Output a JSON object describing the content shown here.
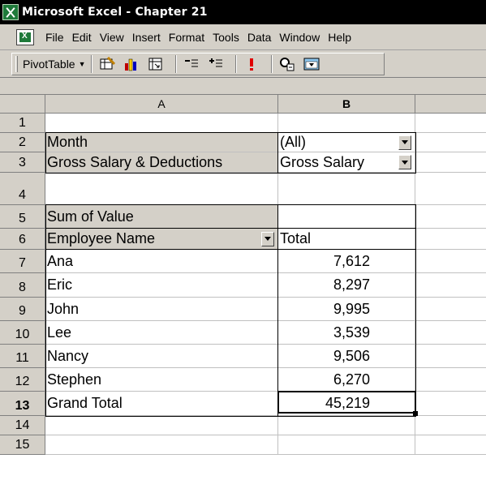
{
  "window": {
    "title": "Microsoft Excel - Chapter 21"
  },
  "menu": [
    "File",
    "Edit",
    "View",
    "Insert",
    "Format",
    "Tools",
    "Data",
    "Window",
    "Help"
  ],
  "toolbar": {
    "pivottable_label": "PivotTable",
    "icons": [
      "format-report-icon",
      "chart-wizard-icon",
      "pivottable-wizard-icon",
      "hide-detail-icon",
      "show-detail-icon",
      "refresh-data-icon",
      "field-settings-icon",
      "show-field-list-icon"
    ]
  },
  "columns": {
    "a": "A",
    "b": "B"
  },
  "rows": [
    "1",
    "2",
    "3",
    "4",
    "5",
    "6",
    "7",
    "8",
    "9",
    "10",
    "11",
    "12",
    "13",
    "14",
    "15"
  ],
  "pivot": {
    "page_fields": [
      {
        "label": "Month",
        "value": "(All)"
      },
      {
        "label": "Gross Salary & Deductions",
        "value": "Gross Salary"
      }
    ],
    "data_label": "Sum of Value",
    "row_field": "Employee Name",
    "total_header": "Total",
    "items": [
      {
        "name": "Ana",
        "value": "7,612"
      },
      {
        "name": "Eric",
        "value": "8,297"
      },
      {
        "name": "John",
        "value": "9,995"
      },
      {
        "name": "Lee",
        "value": "3,539"
      },
      {
        "name": "Nancy",
        "value": "9,506"
      },
      {
        "name": "Stephen",
        "value": "6,270"
      }
    ],
    "grand_total_label": "Grand Total",
    "grand_total_value": "45,219"
  },
  "colors": {
    "title_bar": "#000000",
    "chrome": "#d4d0c8",
    "accent_green": "#1f7a3a"
  }
}
